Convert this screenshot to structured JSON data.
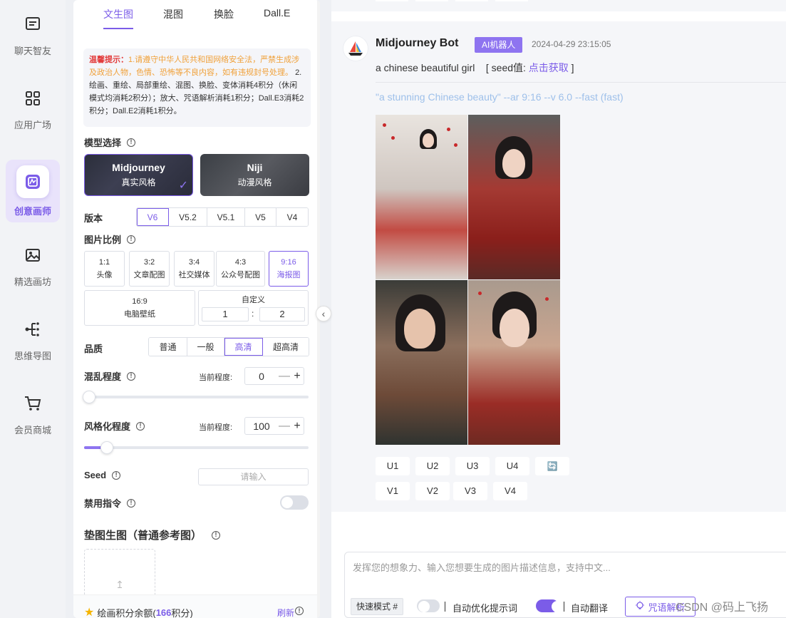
{
  "nav": {
    "items": [
      {
        "label": "聊天智友",
        "icon": "chat-icon",
        "active": false
      },
      {
        "label": "应用广场",
        "icon": "grid-icon",
        "active": false
      },
      {
        "label": "创意画师",
        "icon": "paint-icon",
        "active": true
      },
      {
        "label": "精选画坊",
        "icon": "image-icon",
        "active": false
      },
      {
        "label": "思维导图",
        "icon": "mindmap-icon",
        "active": false
      },
      {
        "label": "会员商城",
        "icon": "cart-icon",
        "active": false
      }
    ]
  },
  "panel": {
    "tabs": [
      "文生图",
      "混图",
      "换脸",
      "Dall.E"
    ],
    "active_tab": "文生图",
    "notice": {
      "title": "温馨提示：",
      "warning": "1.请遵守中华人民共和国网络安全法，严禁生成涉及政治人物，色情、恐怖等不良内容，如有违规封号处理。",
      "rules": "2.绘画、重绘、局部重绘、混图、换脸、变体消耗4积分（休闲模式均消耗2积分）；放大、咒语解析消耗1积分；Dall.E3消耗2积分；Dall.E2消耗1积分。"
    },
    "model": {
      "label": "模型选择",
      "options": [
        {
          "name": "Midjourney",
          "sub": "真实风格",
          "selected": true
        },
        {
          "name": "Niji",
          "sub": "动漫风格",
          "selected": false
        }
      ],
      "check": "✓"
    },
    "version": {
      "label": "版本",
      "options": [
        "V6",
        "V5.2",
        "V5.1",
        "V5",
        "V4"
      ],
      "selected": "V6"
    },
    "ratio": {
      "label": "图片比例",
      "options": [
        {
          "ratio": "1:1",
          "desc": "头像"
        },
        {
          "ratio": "3:2",
          "desc": "文章配图"
        },
        {
          "ratio": "3:4",
          "desc": "社交媒体"
        },
        {
          "ratio": "4:3",
          "desc": "公众号配图"
        },
        {
          "ratio": "9:16",
          "desc": "海报图"
        },
        {
          "ratio": "16:9",
          "desc": "电脑壁纸"
        }
      ],
      "selected": "9:16",
      "custom_label": "自定义",
      "custom_w": "1",
      "custom_sep": ":",
      "custom_h": "2"
    },
    "quality": {
      "label": "品质",
      "options": [
        "普通",
        "一般",
        "高清",
        "超高清"
      ],
      "selected": "高清"
    },
    "chaos": {
      "label": "混乱程度",
      "current_label": "当前程度:",
      "value": "0",
      "minus": "—",
      "plus": "+",
      "level": 0
    },
    "stylize": {
      "label": "风格化程度",
      "current_label": "当前程度:",
      "value": "100",
      "minus": "—",
      "plus": "+",
      "level": 0.1
    },
    "seed": {
      "label": "Seed",
      "placeholder": "请输入"
    },
    "no_cmd": {
      "label": "禁用指令",
      "on": false
    },
    "ref_image": {
      "label": "垫图生图（普通参考图）",
      "upload_icon": "↥"
    },
    "footer": {
      "star": "★",
      "credits_prefix": "绘画积分余额(",
      "credits_value": "166",
      "credits_suffix": "积分)",
      "refresh": "刷新"
    },
    "collapse": "‹"
  },
  "chat": {
    "message": {
      "bot_name": "Midjourney Bot",
      "badge": "AI机器人",
      "time": "2024-04-29 23:15:05",
      "prompt": "a chinese beautiful girl",
      "seed_prefix": "[ seed值: ",
      "seed_link": "点击获取",
      "seed_suffix": " ]",
      "result_prompt": "\"a stunning Chinese beauty\" --ar 9:16 --v 6.0 --fast  (fast)",
      "upscale_buttons": [
        "U1",
        "U2",
        "U3",
        "U4"
      ],
      "variation_buttons": [
        "V1",
        "V2",
        "V3",
        "V4"
      ],
      "reroll": "🔄"
    },
    "input": {
      "placeholder": "发挥您的想象力、输入您想要生成的图片描述信息，支持中文...",
      "mode": "快速模式 #",
      "auto_optimize": "自动优化提示词",
      "auto_optimize_on": false,
      "auto_translate": "自动翻译",
      "auto_translate_on": true,
      "spell_button": "咒语解析"
    }
  },
  "watermark": "CSDN @码上飞扬",
  "colors": {
    "accent": "#7b5ce8",
    "warning": "#f0a13a",
    "danger": "#e23b3b",
    "muted_link": "#9ec0ea"
  }
}
